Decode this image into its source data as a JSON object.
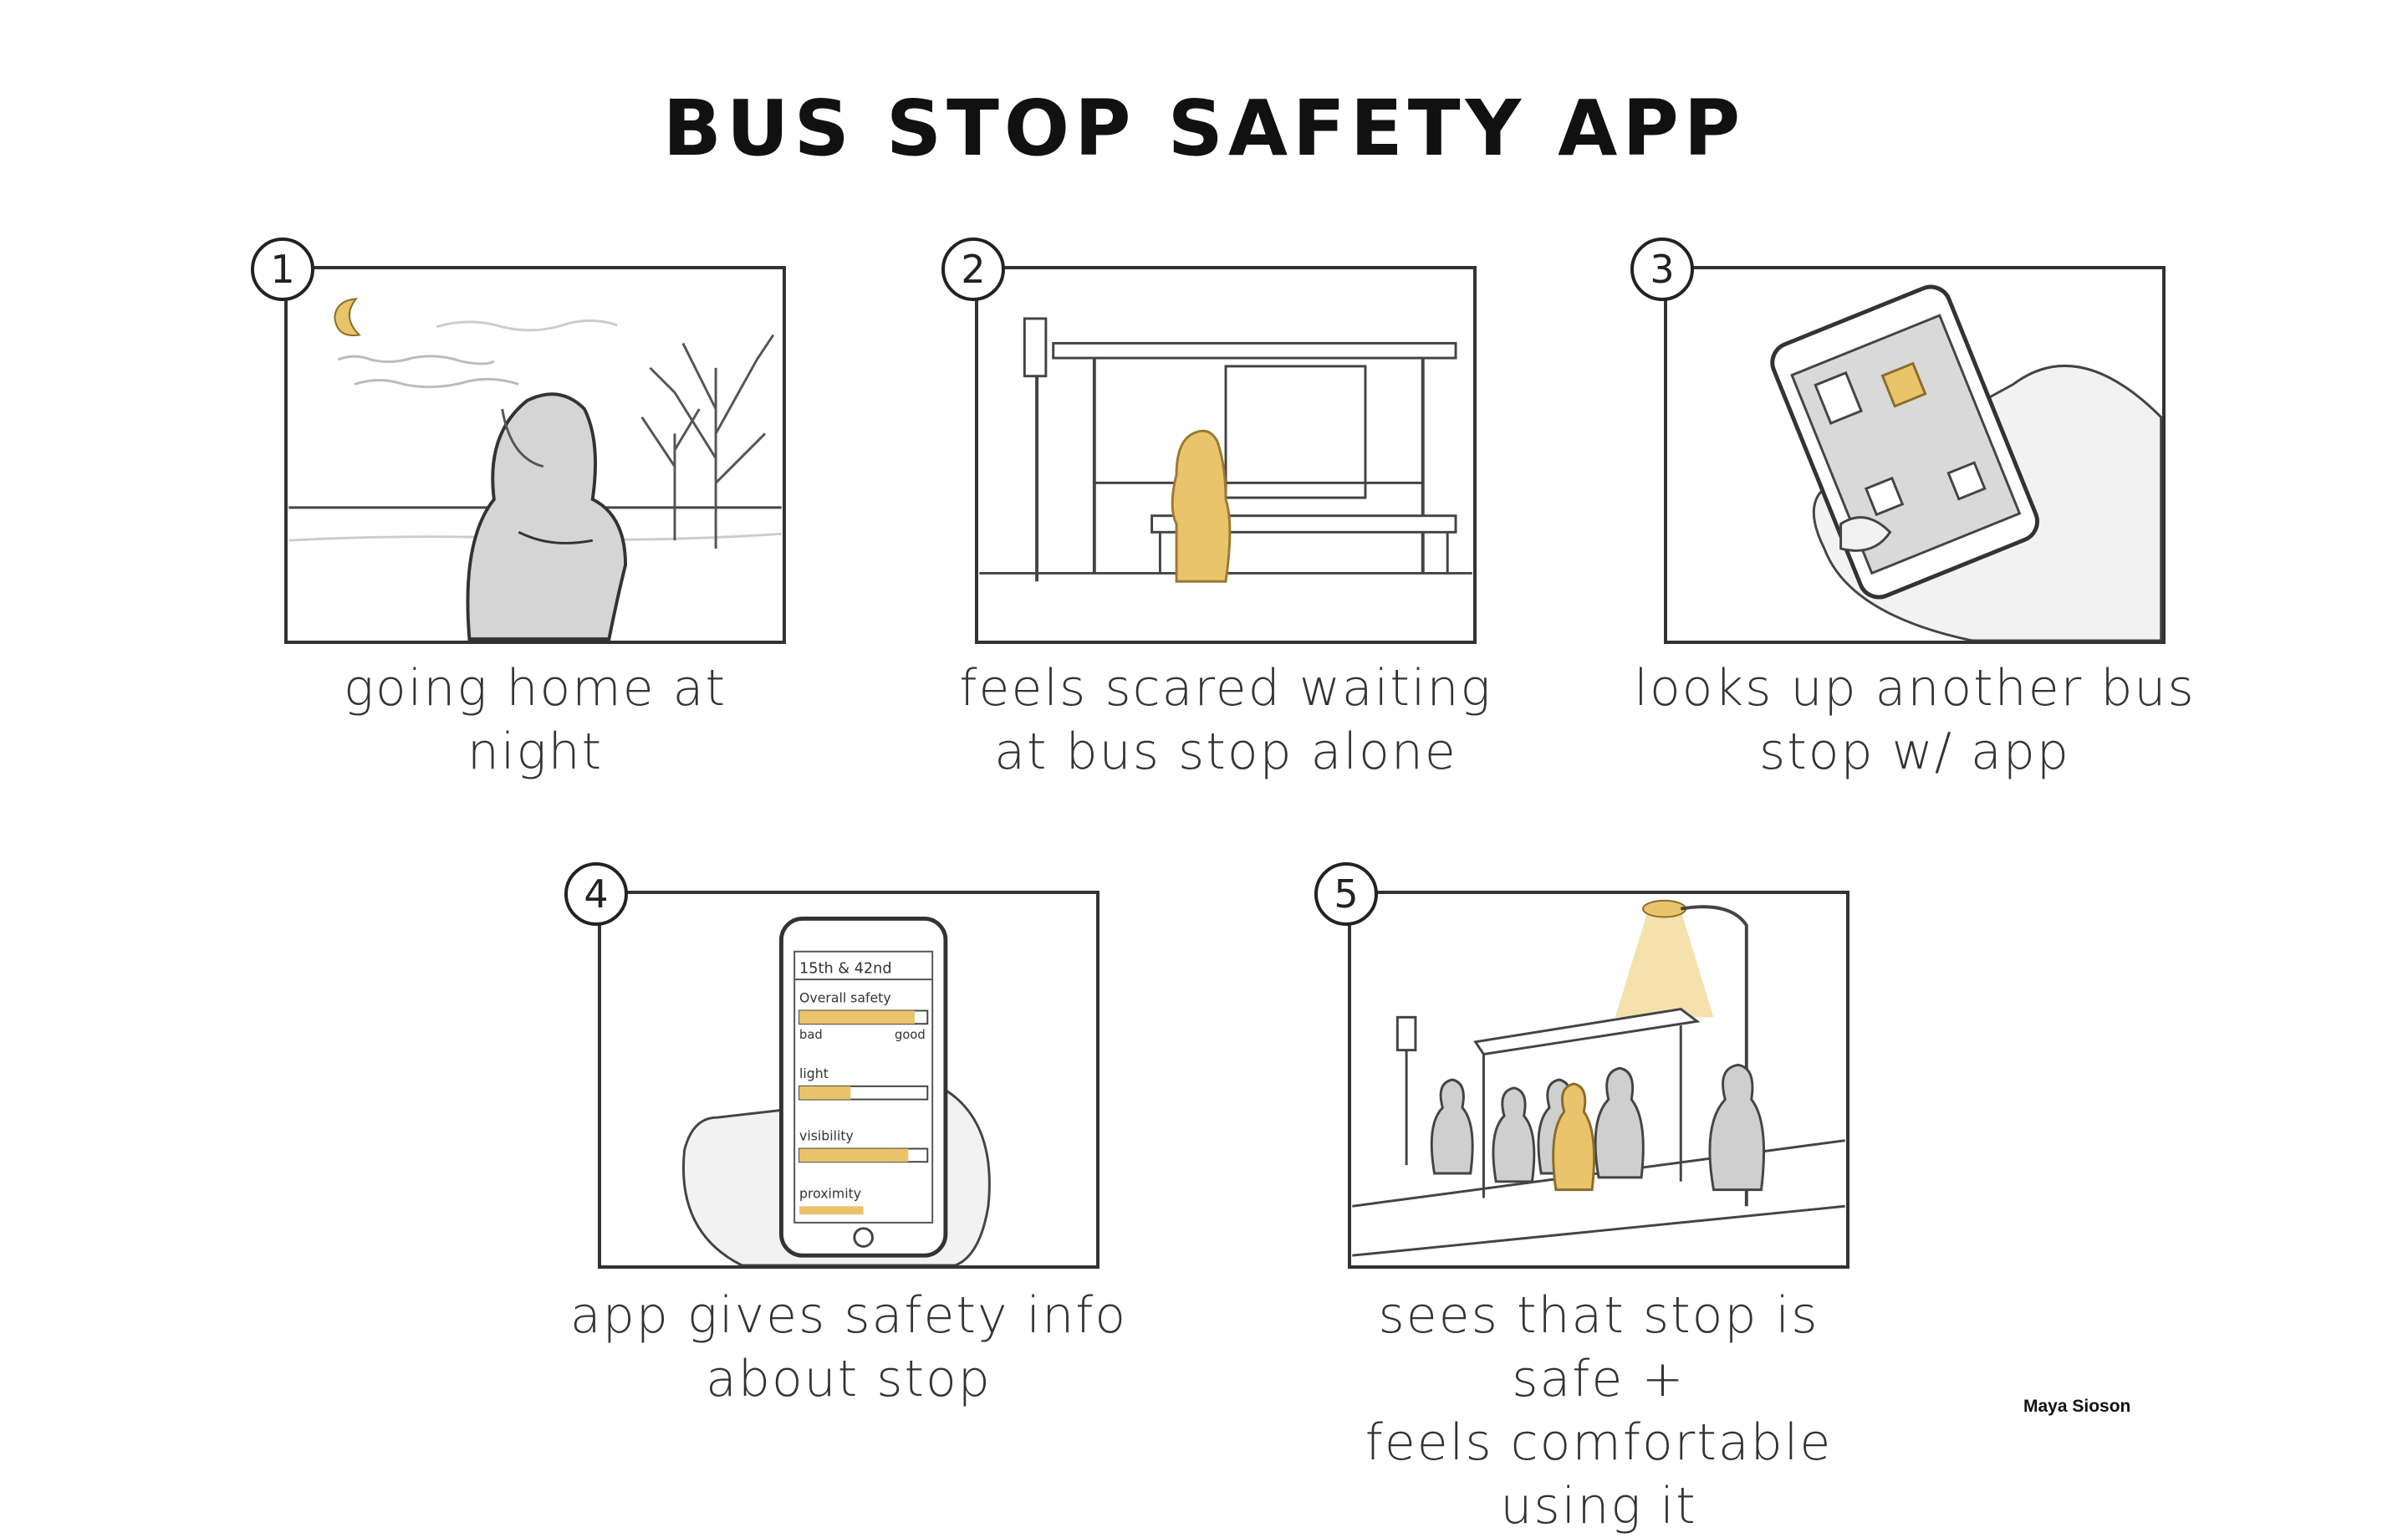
{
  "title": "BUS STOP SAFETY APP",
  "panels": [
    {
      "number": "1",
      "caption": "going home at\nnight"
    },
    {
      "number": "2",
      "caption": "feels scared waiting\nat bus stop alone"
    },
    {
      "number": "3",
      "caption": "looks up another bus\nstop w/ app"
    },
    {
      "number": "4",
      "caption": "app gives safety info\nabout stop"
    },
    {
      "number": "5",
      "caption": "sees that stop is safe +\nfeels comfortable using it"
    }
  ],
  "phone_screen": {
    "location": "15th & 42nd",
    "overall_label": "Overall safety",
    "bad_label": "bad",
    "good_label": "good",
    "metrics": [
      {
        "label": "light",
        "level": 0.4
      },
      {
        "label": "visibility",
        "level": 0.85
      },
      {
        "label": "proximity",
        "level": 0.5
      }
    ],
    "overall_level": 0.9
  },
  "credit": "Maya Sioson",
  "colors": {
    "highlight": "#e9c46a",
    "ink": "#333333",
    "shade": "#b8b8b8"
  }
}
